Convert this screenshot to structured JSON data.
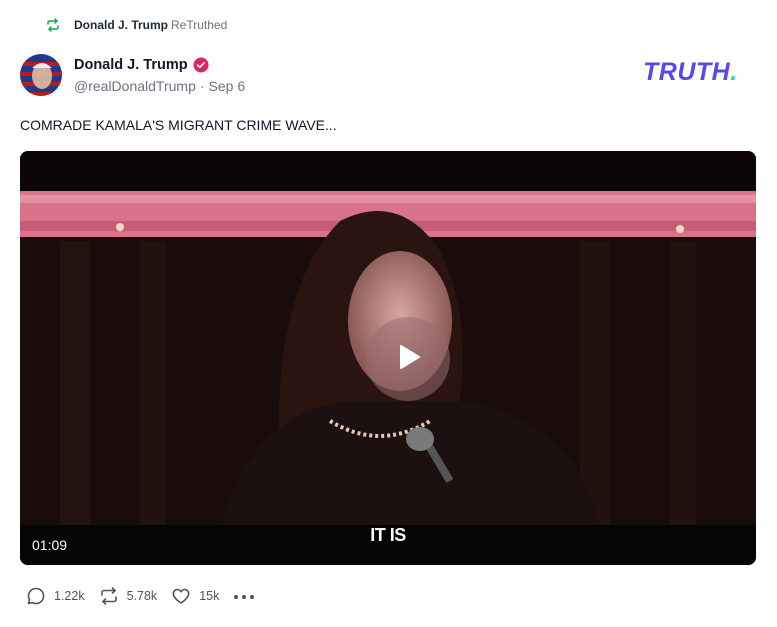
{
  "retruth": {
    "name": "Donald J. Trump",
    "suffix": "ReTruthed",
    "icon": "retruth-icon"
  },
  "post": {
    "author_name": "Donald J. Trump",
    "handle": "@realDonaldTrump",
    "separator": "·",
    "date": "Sep 6",
    "text": "COMRADE KAMALA'S MIGRANT CRIME WAVE..."
  },
  "logo": {
    "text": "TRUTH",
    "dot": ".",
    "color": "#5448ee",
    "dot_color": "#2dd4bf"
  },
  "video": {
    "caption": "IT IS",
    "duration": "01:09"
  },
  "actions": {
    "replies": "1.22k",
    "retruths": "5.78k",
    "likes": "15k"
  },
  "colors": {
    "verified": "#e0245e",
    "retruth_green": "#16a34a",
    "text_secondary": "#6b7280"
  }
}
